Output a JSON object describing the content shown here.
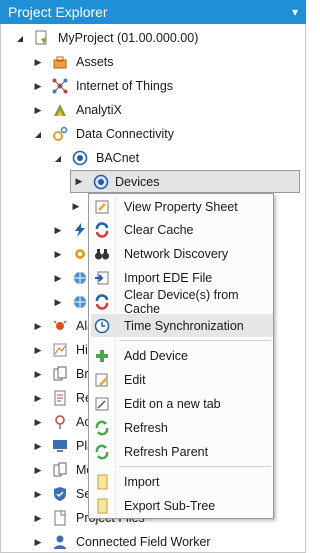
{
  "panel": {
    "title": "Project Explorer",
    "pin_glyph": "▾ ⊿"
  },
  "tree": {
    "root": {
      "label": "MyProject (01.00.000.00)",
      "icon": "project-icon"
    },
    "assets": "Assets",
    "iot": "Internet of Things",
    "analytix": "AnalytiX",
    "data_connectivity": "Data Connectivity",
    "bacnet": "BACnet",
    "devices": "Devices",
    "alarms": "Ala",
    "historian": "His",
    "bridging": "Bri",
    "reports": "Re",
    "ac": "Ac",
    "platform": "Pla",
    "mobile": "Mo",
    "security": "Sec",
    "project_files": "Project Files",
    "cfw": "Connected Field Worker"
  },
  "context_menu": {
    "items": {
      "view_property_sheet": "View Property Sheet",
      "clear_cache": "Clear Cache",
      "network_discovery": "Network Discovery",
      "import_ede": "Import EDE File",
      "clear_device_cache": "Clear Device(s) from Cache",
      "time_sync": "Time Synchronization",
      "add_device": "Add Device",
      "edit": "Edit",
      "edit_new_tab": "Edit on a new tab",
      "refresh": "Refresh",
      "refresh_parent": "Refresh Parent",
      "import": "Import",
      "export_subtree": "Export Sub-Tree"
    }
  },
  "colors": {
    "title_bar": "#1f8fd6",
    "hover": "#e6e6e6",
    "selected": "#e4e4e4"
  }
}
